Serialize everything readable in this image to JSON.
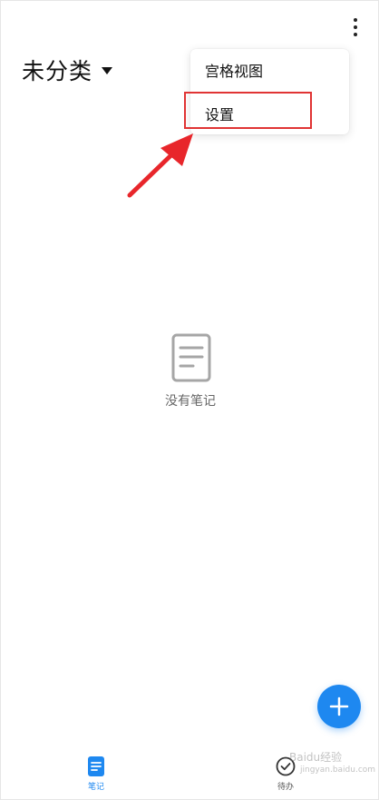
{
  "header": {
    "category_title": "未分类",
    "more_icon": "more-vertical-icon"
  },
  "menu": {
    "items": [
      {
        "label": "宫格视图"
      },
      {
        "label": "设置"
      }
    ],
    "highlighted_item": "设置",
    "highlight_color": "#e03434"
  },
  "empty_state": {
    "icon": "document-icon",
    "text": "没有笔记"
  },
  "fab": {
    "icon": "plus-icon",
    "color": "#1e88f0"
  },
  "bottom_nav": {
    "tabs": [
      {
        "label": "笔记",
        "icon": "note-icon",
        "active": true
      },
      {
        "label": "待办",
        "icon": "check-circle-icon",
        "active": false
      }
    ],
    "active_color": "#1e88f0"
  },
  "annotation": {
    "arrow_color": "#e8262b"
  },
  "watermark": {
    "text": "Baidu经验",
    "subtext": "jingyan.baidu.com"
  }
}
